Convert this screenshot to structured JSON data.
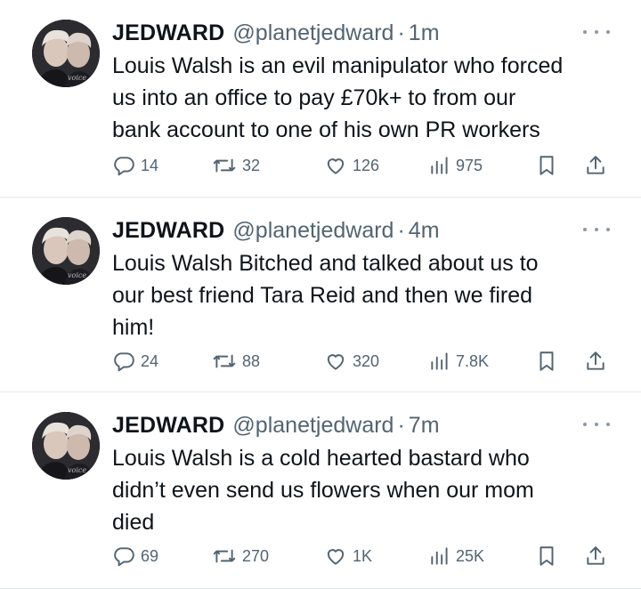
{
  "tweets": [
    {
      "name": "JEDWARD",
      "handle": "@planetjedward",
      "separator": "·",
      "time": "1m",
      "text": "Louis Walsh is an evil manipulator who forced\nus into an office to pay £70k+ to from our\nbank account to one of his own PR workers",
      "replies": "14",
      "retweets": "32",
      "likes": "126",
      "views": "975"
    },
    {
      "name": "JEDWARD",
      "handle": "@planetjedward",
      "separator": "·",
      "time": "4m",
      "text": "Louis Walsh Bitched and talked about us to\nour best friend Tara Reid and then we fired\nhim!",
      "replies": "24",
      "retweets": "88",
      "likes": "320",
      "views": "7.8K"
    },
    {
      "name": "JEDWARD",
      "handle": "@planetjedward",
      "separator": "·",
      "time": "7m",
      "text": "Louis Walsh is a cold hearted bastard who\ndidn’t even send us flowers when our mom\ndied",
      "replies": "69",
      "retweets": "270",
      "likes": "1K",
      "views": "25K"
    }
  ],
  "icons": {
    "reply": "speech-bubble-icon",
    "retweet": "retweet-arrows-icon",
    "like": "heart-icon",
    "views": "bar-chart-icon",
    "bookmark": "bookmark-icon",
    "share": "share-upload-icon",
    "more": "more-dots-icon"
  },
  "colors": {
    "text": "#0f1419",
    "secondary": "#536471",
    "divider": "#e6e9ec"
  }
}
